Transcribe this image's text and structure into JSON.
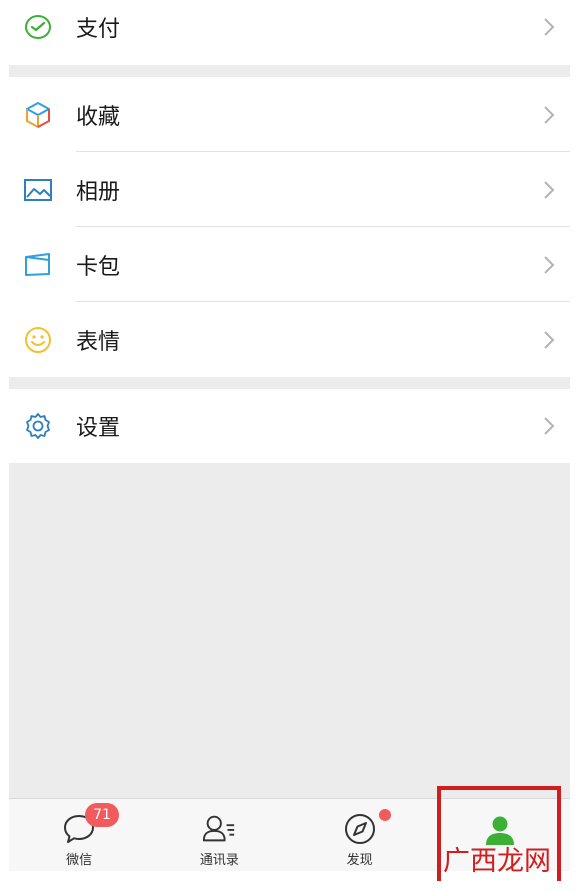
{
  "menu": {
    "group1": [
      {
        "label": "支付",
        "icon": "wallet-icon"
      }
    ],
    "group2": [
      {
        "label": "收藏",
        "icon": "cube-icon"
      },
      {
        "label": "相册",
        "icon": "photo-icon"
      },
      {
        "label": "卡包",
        "icon": "card-icon"
      },
      {
        "label": "表情",
        "icon": "smiley-icon"
      }
    ],
    "group3": [
      {
        "label": "设置",
        "icon": "gear-icon"
      }
    ]
  },
  "tabbar": {
    "tabs": [
      {
        "label": "微信",
        "icon": "chat-bubble-icon",
        "badge": "71"
      },
      {
        "label": "通讯录",
        "icon": "contacts-icon"
      },
      {
        "label": "发现",
        "icon": "compass-icon",
        "dot": true
      },
      {
        "label": "",
        "icon": "person-icon",
        "active": true
      }
    ]
  },
  "watermark": {
    "text": "广西龙网"
  },
  "colors": {
    "accent": "#3cb034",
    "badge": "#f15b5b",
    "highlight": "#d01e1e",
    "background": "#ececec"
  }
}
